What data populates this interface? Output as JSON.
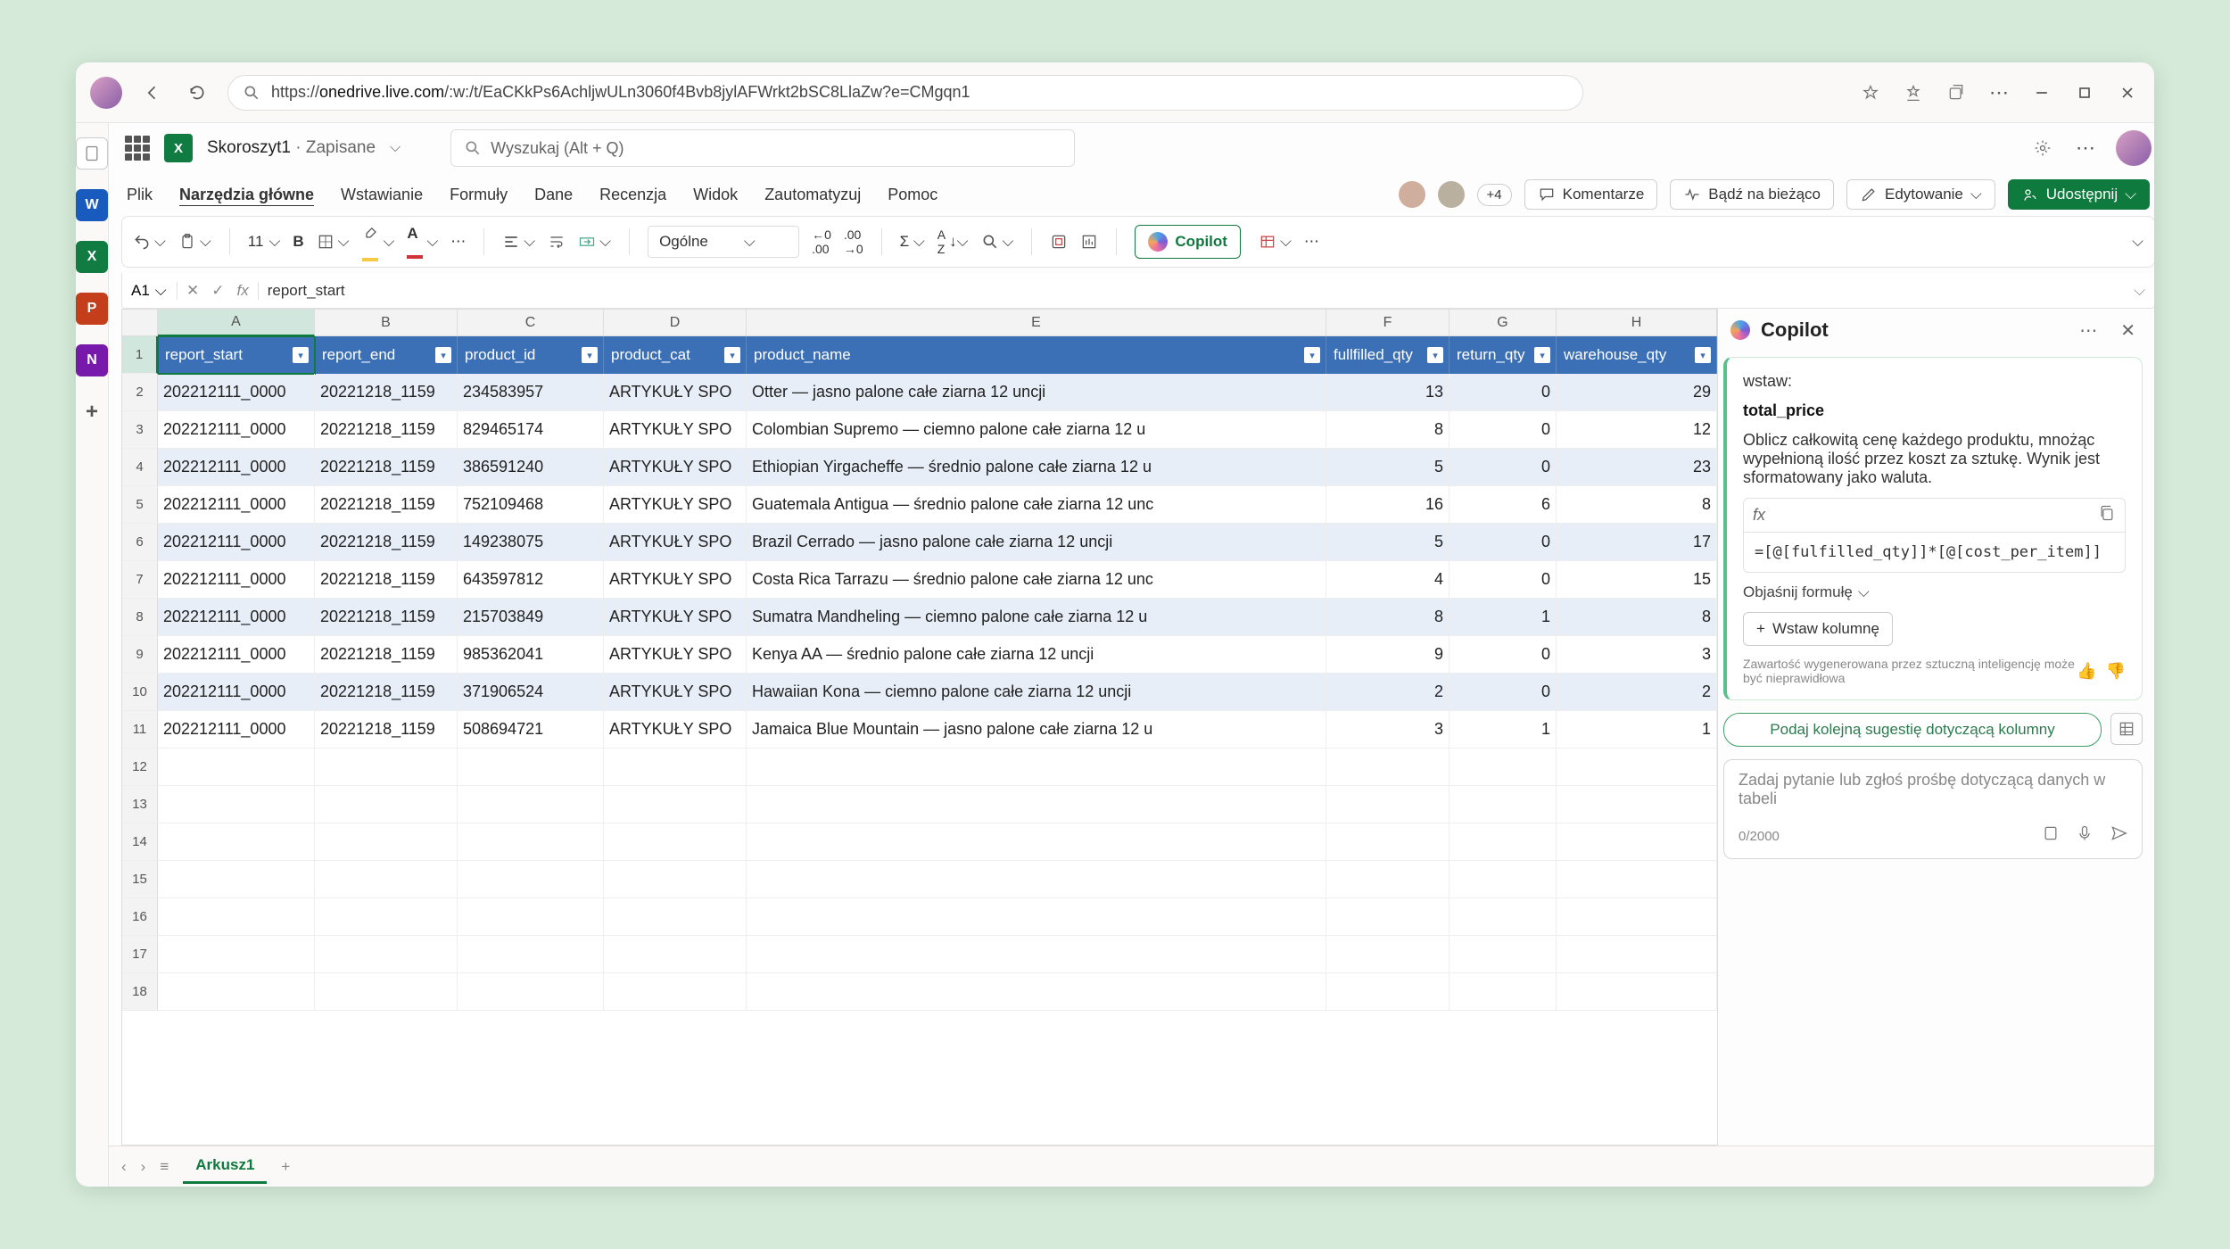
{
  "browser": {
    "url_prefix": "https://",
    "url_host": "onedrive.live.com",
    "url_path": "/:w:/t/EaCKkPs6AchljwULn3060f4Bvb8jylAFWrkt2bSC8LlaZw?e=CMgqn1"
  },
  "title_row": {
    "doc_name": "Skoroszyt1",
    "saved_state": " · Zapisane",
    "search_placeholder": "Wyszukaj (Alt + Q)"
  },
  "menu": {
    "tabs": [
      "Plik",
      "Narzędzia główne",
      "Wstawianie",
      "Formuły",
      "Dane",
      "Recenzja",
      "Widok",
      "Zautomatyzuj",
      "Pomoc"
    ],
    "active_index": 1,
    "plus_count": "+4",
    "comments": "Komentarze",
    "catch_up": "Bądź na bieżąco",
    "editing": "Edytowanie",
    "share": "Udostępnij"
  },
  "ribbon": {
    "font_size": "11",
    "number_format": "Ogólne",
    "copilot": "Copilot"
  },
  "formula_bar": {
    "cell_ref": "A1",
    "formula": "report_start"
  },
  "sheet": {
    "columns": [
      "A",
      "B",
      "C",
      "D",
      "E",
      "F",
      "G",
      "H"
    ],
    "headers": [
      "report_start",
      "report_end",
      "product_id",
      "product_cat",
      "product_name",
      "fullfilled_qty",
      "return_qty",
      "warehouse_qty"
    ],
    "active_col_index": 0,
    "rows": [
      {
        "a": "202212111_0000",
        "b": "20221218_1159",
        "c": "234583957",
        "d": "ARTYKUŁY SPO",
        "e": "Otter — jasno palone całe ziarna 12 uncji",
        "f": "13",
        "g": "0",
        "h": "29"
      },
      {
        "a": "202212111_0000",
        "b": "20221218_1159",
        "c": "829465174",
        "d": "ARTYKUŁY SPO",
        "e": "Colombian Supremo — ciemno palone całe ziarna 12 u",
        "f": "8",
        "g": "0",
        "h": "12"
      },
      {
        "a": "202212111_0000",
        "b": "20221218_1159",
        "c": "386591240",
        "d": "ARTYKUŁY SPO",
        "e": "Ethiopian Yirgacheffe — średnio palone całe ziarna 12 u",
        "f": "5",
        "g": "0",
        "h": "23"
      },
      {
        "a": "202212111_0000",
        "b": "20221218_1159",
        "c": "752109468",
        "d": "ARTYKUŁY SPO",
        "e": "Guatemala Antigua — średnio palone całe ziarna 12 unc",
        "f": "16",
        "g": "6",
        "h": "8"
      },
      {
        "a": "202212111_0000",
        "b": "20221218_1159",
        "c": "149238075",
        "d": "ARTYKUŁY SPO",
        "e": "Brazil Cerrado — jasno palone całe ziarna 12 uncji",
        "f": "5",
        "g": "0",
        "h": "17"
      },
      {
        "a": "202212111_0000",
        "b": "20221218_1159",
        "c": "643597812",
        "d": "ARTYKUŁY SPO",
        "e": "Costa Rica Tarrazu — średnio palone całe ziarna 12 unc",
        "f": "4",
        "g": "0",
        "h": "15"
      },
      {
        "a": "202212111_0000",
        "b": "20221218_1159",
        "c": "215703849",
        "d": "ARTYKUŁY SPO",
        "e": "Sumatra Mandheling — ciemno palone całe ziarna 12 u",
        "f": "8",
        "g": "1",
        "h": "8"
      },
      {
        "a": "202212111_0000",
        "b": "20221218_1159",
        "c": "985362041",
        "d": "ARTYKUŁY SPO",
        "e": "Kenya AA — średnio palone całe ziarna 12 uncji",
        "f": "9",
        "g": "0",
        "h": "3"
      },
      {
        "a": "202212111_0000",
        "b": "20221218_1159",
        "c": "371906524",
        "d": "ARTYKUŁY SPO",
        "e": "Hawaiian Kona — ciemno palone całe ziarna 12 uncji",
        "f": "2",
        "g": "0",
        "h": "2"
      },
      {
        "a": "202212111_0000",
        "b": "20221218_1159",
        "c": "508694721",
        "d": "ARTYKUŁY SPO",
        "e": "Jamaica Blue Mountain — jasno palone całe ziarna 12 u",
        "f": "3",
        "g": "1",
        "h": "1"
      }
    ],
    "empty_rows": [
      12,
      13,
      14,
      15,
      16,
      17,
      18
    ],
    "sheet_tab": "Arkusz1"
  },
  "copilot": {
    "title": "Copilot",
    "line1": "wstaw:",
    "field_name": "total_price",
    "description": "Oblicz całkowitą cenę każdego produktu, mnożąc wypełnioną ilość przez koszt za sztukę. Wynik jest sformatowany jako waluta.",
    "formula": "=[@[fulfilled_qty]]*[@[cost_per_item]]",
    "explain": "Objaśnij formułę",
    "insert_col": "Wstaw kolumnę",
    "disclaimer": "Zawartość wygenerowana przez sztuczną inteligencję może być nieprawidłowa",
    "suggest_next": "Podaj kolejną sugestię dotyczącą kolumny",
    "input_placeholder": "Zadaj pytanie lub zgłoś prośbę dotyczącą danych w tabeli",
    "char_count": "0/2000"
  }
}
